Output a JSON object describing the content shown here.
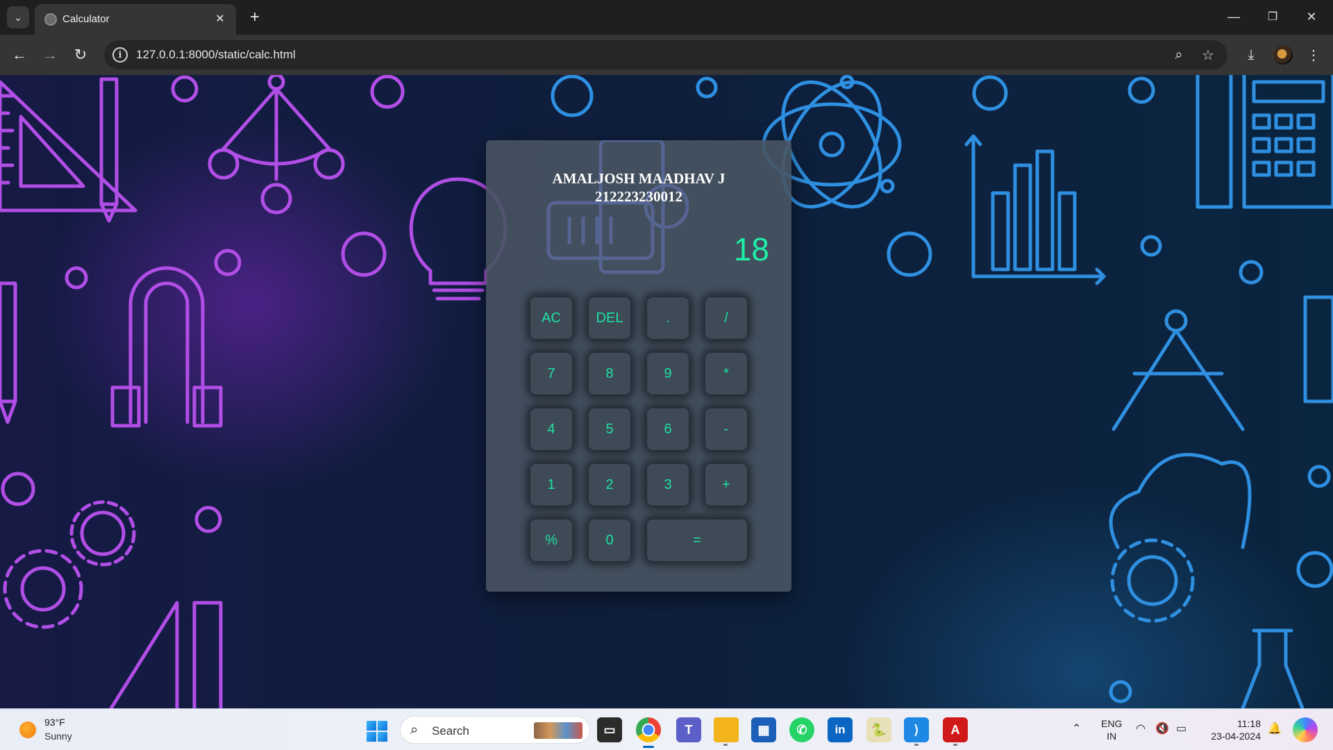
{
  "browser": {
    "tab_title": "Calculator",
    "url": "127.0.0.1:8000/static/calc.html",
    "icons": [
      "tab-search-icon",
      "favicon-icon",
      "close-icon",
      "plus-icon",
      "minimize-icon",
      "restore-icon",
      "close-window-icon",
      "back-icon",
      "forward-icon",
      "reload-icon",
      "site-info-icon",
      "zoom-icon",
      "bookmark-star-icon",
      "download-icon",
      "menu-icon"
    ]
  },
  "calculator": {
    "name": "AMALJOSH MAADHAV J",
    "reg_no": "212223230012",
    "display": "18",
    "keys": [
      {
        "label": "AC"
      },
      {
        "label": "DEL"
      },
      {
        "label": "."
      },
      {
        "label": "/"
      },
      {
        "label": "7"
      },
      {
        "label": "8"
      },
      {
        "label": "9"
      },
      {
        "label": "*"
      },
      {
        "label": "4"
      },
      {
        "label": "5"
      },
      {
        "label": "6"
      },
      {
        "label": "-"
      },
      {
        "label": "1"
      },
      {
        "label": "2"
      },
      {
        "label": "3"
      },
      {
        "label": "+"
      },
      {
        "label": "%"
      },
      {
        "label": "0"
      },
      {
        "label": "="
      }
    ],
    "colors": {
      "accent": "#1ff0a8",
      "panel": "#485462",
      "key": "#3e4a56"
    }
  },
  "taskbar": {
    "weather_temp": "93°F",
    "weather_desc": "Sunny",
    "search_placeholder": "Search",
    "lang_line1": "ENG",
    "lang_line2": "IN",
    "time": "11:18",
    "date": "23-04-2024"
  }
}
